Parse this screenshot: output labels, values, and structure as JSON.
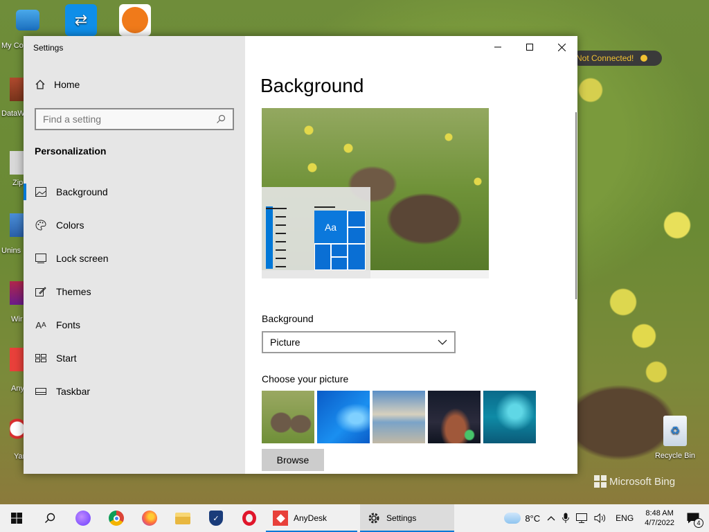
{
  "desktop": {
    "icons_left_labels": [
      "My Co",
      "DataW",
      "Zip",
      "Unins",
      "Wir",
      "Any",
      "Yan"
    ],
    "recycle_bin_label": "Recycle Bin",
    "not_connected_label": "Not Connected!",
    "watermark": "Microsoft Bing"
  },
  "window": {
    "title": "Settings",
    "controls": {
      "minimize": "—",
      "maximize": "☐",
      "close": "✕"
    }
  },
  "sidebar": {
    "home_label": "Home",
    "search_placeholder": "Find a setting",
    "section_heading": "Personalization",
    "items": [
      {
        "label": "Background",
        "icon": "image-icon",
        "glyph": "▭",
        "active": true
      },
      {
        "label": "Colors",
        "icon": "palette-icon",
        "glyph": "🎨",
        "active": false
      },
      {
        "label": "Lock screen",
        "icon": "lock-screen-icon",
        "glyph": "▭",
        "active": false
      },
      {
        "label": "Themes",
        "icon": "brush-icon",
        "glyph": "✎",
        "active": false
      },
      {
        "label": "Fonts",
        "icon": "fonts-icon",
        "glyph": "A",
        "active": false
      },
      {
        "label": "Start",
        "icon": "start-icon",
        "glyph": "⊞",
        "active": false
      },
      {
        "label": "Taskbar",
        "icon": "taskbar-icon",
        "glyph": "▬",
        "active": false
      }
    ]
  },
  "content": {
    "page_title": "Background",
    "preview_tile_text": "Aa",
    "background_label": "Background",
    "background_selected": "Picture",
    "choose_picture_label": "Choose your picture",
    "browse_label": "Browse"
  },
  "taskbar": {
    "apps": [
      {
        "label": "AnyDesk",
        "open": true,
        "active": false
      },
      {
        "label": "Settings",
        "open": true,
        "active": true
      }
    ],
    "temperature": "8°C",
    "language": "ENG",
    "time": "8:48 AM",
    "date": "4/7/2022",
    "notifications_count": "4",
    "colors": {
      "accent": "#0078d7"
    }
  }
}
